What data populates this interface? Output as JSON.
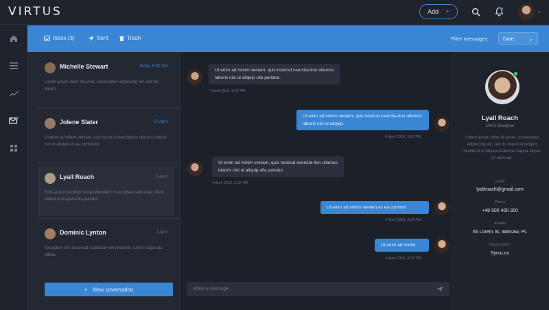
{
  "brand": {
    "logo": "VIRTUS"
  },
  "topbar": {
    "add_label": "Add",
    "add_plus": "+",
    "caret": "⌄"
  },
  "tabs": [
    {
      "label": "Inbox (3)",
      "icon": "inbox-icon"
    },
    {
      "label": "Sent",
      "icon": "send-icon"
    },
    {
      "label": "Trash",
      "icon": "trash-icon"
    }
  ],
  "filter": {
    "label": "Filter messages:",
    "selected": "Date",
    "caret": "⌄"
  },
  "conversations": [
    {
      "name": "Michelle Stewart",
      "time": "Today, 5:32 PM",
      "time_color": "#3a86d4",
      "snippet": "Lorem ipsum dolor sit amet, consectetur adipiscing elit, sed do eiusm.",
      "avatar_color": "#8a6a52"
    },
    {
      "name": "Jolene Slater",
      "time": "10 April",
      "time_color": "#3a86d4",
      "snippet": "Ut enim ad minim veniam, quis nostrud exercitation ullamco laboris nisi ut aliquip ex ea commodo.",
      "avatar_color": "#9a7a66"
    },
    {
      "name": "Lyall Roach",
      "time": "6 April",
      "time_color": "#6b7282",
      "snippet": "Duis aute irure dolor in reprehenderit in voluptate velit esse cillum dolore eu fugiat nulla pariatur.",
      "avatar_color": "#b29a86"
    },
    {
      "name": "Dominic Lynton",
      "time": "2 April",
      "time_color": "#6b7282",
      "snippet": "Excepteur sint occaecat cupidatat non proident, sunt in culpa qui officia.",
      "avatar_color": "#a57f62"
    }
  ],
  "new_conversation": {
    "label": "New coversation",
    "plus": "+"
  },
  "messages": [
    {
      "direction": "in",
      "text": "Ut enim ad minim veniam, quis nostrud exercita-tion ullamco laboris nisi ut aliquip ulla pariatur.",
      "stamp": "4 April 2018, 3:32 PM"
    },
    {
      "direction": "out",
      "text": "Ut enim ad minim veniam, quis nostrud exercita-tion ullamco laboris nisi ut aliquip.",
      "stamp": "4 April 2018, 3:32 PM"
    },
    {
      "direction": "in",
      "text": "Ut enim ad minim veniam, quis nostrud exercita-tion ullamco laboris nisi ut aliquip ulla pariatur.",
      "stamp": "4 April 2018, 3:32 PM"
    },
    {
      "direction": "out",
      "text": "Ut enim ad minim veniam,ex ea commo!",
      "stamp": "4 April 2018, 3:32 PM"
    },
    {
      "direction": "out",
      "text": "Ut enim ad minim",
      "stamp": "4 April 2018, 3:32 PM"
    }
  ],
  "composer": {
    "placeholder": "Write a message"
  },
  "profile": {
    "name": "Lyall Roach",
    "role": "UX/UI Designer",
    "bio": "Lorem ipsum dolor sit amet, consectetur adipiscing elit, sed do eiusmod tempor incididunt ut labore et dolore magna aliqua. Ut enim ad.",
    "fields": [
      {
        "label": "Email",
        "value": "lyallroach@gmail.com"
      },
      {
        "label": "Phone",
        "value": "+48 500 400 300"
      },
      {
        "label": "Adress",
        "value": "65 Lorem St, Warsaw, PL"
      },
      {
        "label": "Organization",
        "value": "Symu.co"
      }
    ]
  },
  "colors": {
    "accent": "#3a86d4",
    "online": "#3ecf6e"
  }
}
